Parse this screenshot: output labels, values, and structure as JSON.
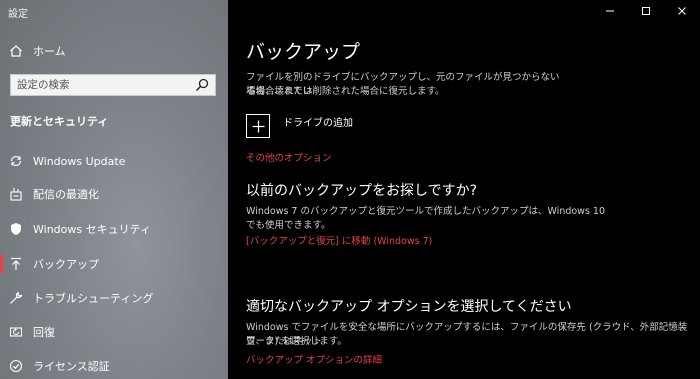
{
  "app_title": "設定",
  "sidebar": {
    "home_label": "ホーム",
    "search_placeholder": "設定の検索",
    "section_title": "更新とセキュリティ",
    "items": [
      {
        "label": "Windows Update",
        "icon": "sync-icon"
      },
      {
        "label": "配信の最適化",
        "icon": "delivery-optimization-icon"
      },
      {
        "label": "Windows セキュリティ",
        "icon": "shield-icon"
      },
      {
        "label": "バックアップ",
        "icon": "backup-arrow-icon",
        "selected": true
      },
      {
        "label": "トラブルシューティング",
        "icon": "wrench-icon"
      },
      {
        "label": "回復",
        "icon": "recovery-icon"
      },
      {
        "label": "ライセンス認証",
        "icon": "check-circle-icon"
      }
    ]
  },
  "window_controls": [
    "minimize",
    "maximize",
    "close"
  ],
  "main": {
    "title": "バックアップ",
    "intro_line1": "ファイルを別のドライブにバックアップし、元のファイルが見つからない場合、壊れてい",
    "intro_line2": "る場合、または削除された場合に復元します。",
    "add_drive_label": "ドライブの追加",
    "more_options_link": "その他のオプション",
    "old_backup_heading": "以前のバックアップをお探しですか?",
    "old_backup_line1": "Windows 7 のバックアップと復元ツールで作成したバックアップは、Windows 10",
    "old_backup_line2": "でも使用できます。",
    "old_backup_link": "[バックアップと復元] に移動 (Windows 7)",
    "choose_heading": "適切なバックアップ オプションを選択してください",
    "choose_line1": "Windows でファイルを安全な場所にバックアップするには、ファイルの保存先 (クラウド、外部記憶装置、またはネット",
    "choose_line2": "ワーク) を選択します。",
    "details_link": "バックアップ オプションの詳細"
  },
  "colors": {
    "accent": "#e8414a",
    "sidebar_bg": "#7c8287",
    "main_bg": "#000000"
  }
}
